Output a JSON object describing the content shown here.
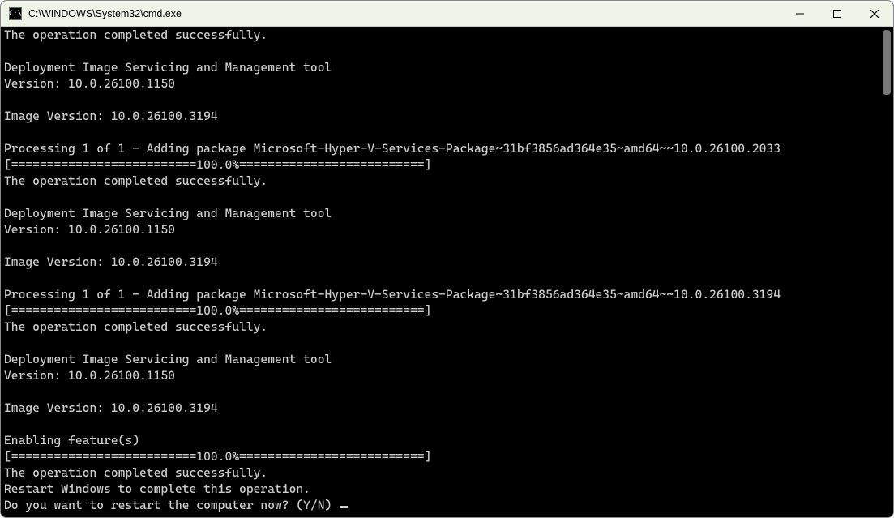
{
  "window": {
    "title": "C:\\WINDOWS\\System32\\cmd.exe",
    "icon_label": "C:\\"
  },
  "terminal": {
    "lines": [
      "The operation completed successfully.",
      "",
      "Deployment Image Servicing and Management tool",
      "Version: 10.0.26100.1150",
      "",
      "Image Version: 10.0.26100.3194",
      "",
      "Processing 1 of 1 - Adding package Microsoft-Hyper-V-Services-Package~31bf3856ad364e35~amd64~~10.0.26100.2033",
      "[==========================100.0%==========================]",
      "The operation completed successfully.",
      "",
      "Deployment Image Servicing and Management tool",
      "Version: 10.0.26100.1150",
      "",
      "Image Version: 10.0.26100.3194",
      "",
      "Processing 1 of 1 - Adding package Microsoft-Hyper-V-Services-Package~31bf3856ad364e35~amd64~~10.0.26100.3194",
      "[==========================100.0%==========================]",
      "The operation completed successfully.",
      "",
      "Deployment Image Servicing and Management tool",
      "Version: 10.0.26100.1150",
      "",
      "Image Version: 10.0.26100.3194",
      "",
      "Enabling feature(s)",
      "[==========================100.0%==========================]",
      "The operation completed successfully.",
      "Restart Windows to complete this operation.",
      "Do you want to restart the computer now? (Y/N) "
    ]
  }
}
